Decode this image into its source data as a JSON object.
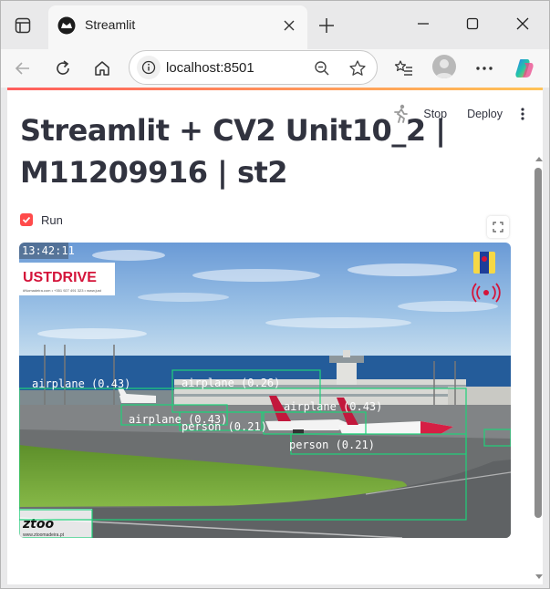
{
  "browser": {
    "tab_title": "Streamlit",
    "url": "localhost:8501"
  },
  "app": {
    "title": "Streamlit + CV2 Unit10_2 | M11209916 | st2",
    "stop_label": "Stop",
    "deploy_label": "Deploy",
    "run_checkbox_label": "Run",
    "run_checked": true
  },
  "video": {
    "timestamp": "13:42:11",
    "ad_text": "USTDRIVE",
    "ad_contact": "#Nomadeira.com • +351 927 491 323 • www.just",
    "webcam_logo": "www.ztoomadeira.pt",
    "detections": [
      {
        "label": "airplane (0.43)"
      },
      {
        "label": "airplane (0.26)"
      },
      {
        "label": "airplane (0.43)"
      },
      {
        "label": "airplane (0.43)"
      },
      {
        "label": "person (0.21)"
      },
      {
        "label": "person (0.21)"
      }
    ]
  },
  "colors": {
    "accent": "#ff4b4b",
    "detection_box": "#1fd17a",
    "text": "#31333f"
  }
}
